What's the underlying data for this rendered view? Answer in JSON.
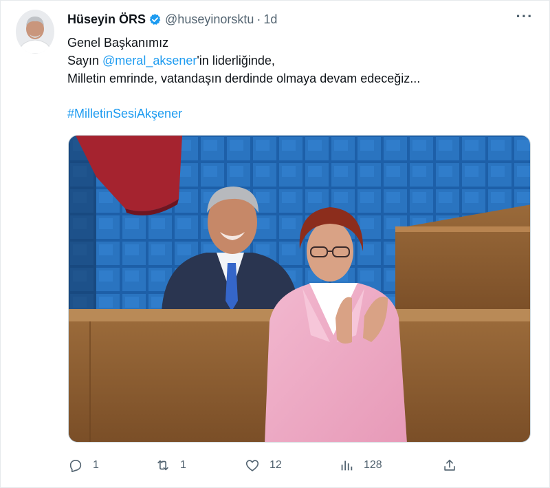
{
  "author": {
    "display_name": "Hüseyin ÖRS",
    "handle": "@huseyinorsktu",
    "separator": "·",
    "time": "1d",
    "verified": true
  },
  "tweet": {
    "line1": "Genel Başkanımız",
    "line2_prefix": "Sayın ",
    "mention": "@meral_aksener",
    "line2_suffix": "'in liderliğinde,",
    "line3": "Milletin emrinde, vatandaşın derdinde olmaya devam edeceğiz...",
    "hashtag": "#MilletinSesiAkşener"
  },
  "actions": {
    "replies": "1",
    "retweets": "1",
    "likes": "12",
    "views": "128"
  },
  "icons": [
    "more-options-icon",
    "verified-badge-icon",
    "reply-icon",
    "retweet-icon",
    "like-icon",
    "views-icon",
    "share-icon"
  ],
  "colors": {
    "link": "#1d9bf0",
    "verified": "#1d9bf0",
    "secondary_text": "#536471",
    "primary_text": "#0f1419"
  }
}
